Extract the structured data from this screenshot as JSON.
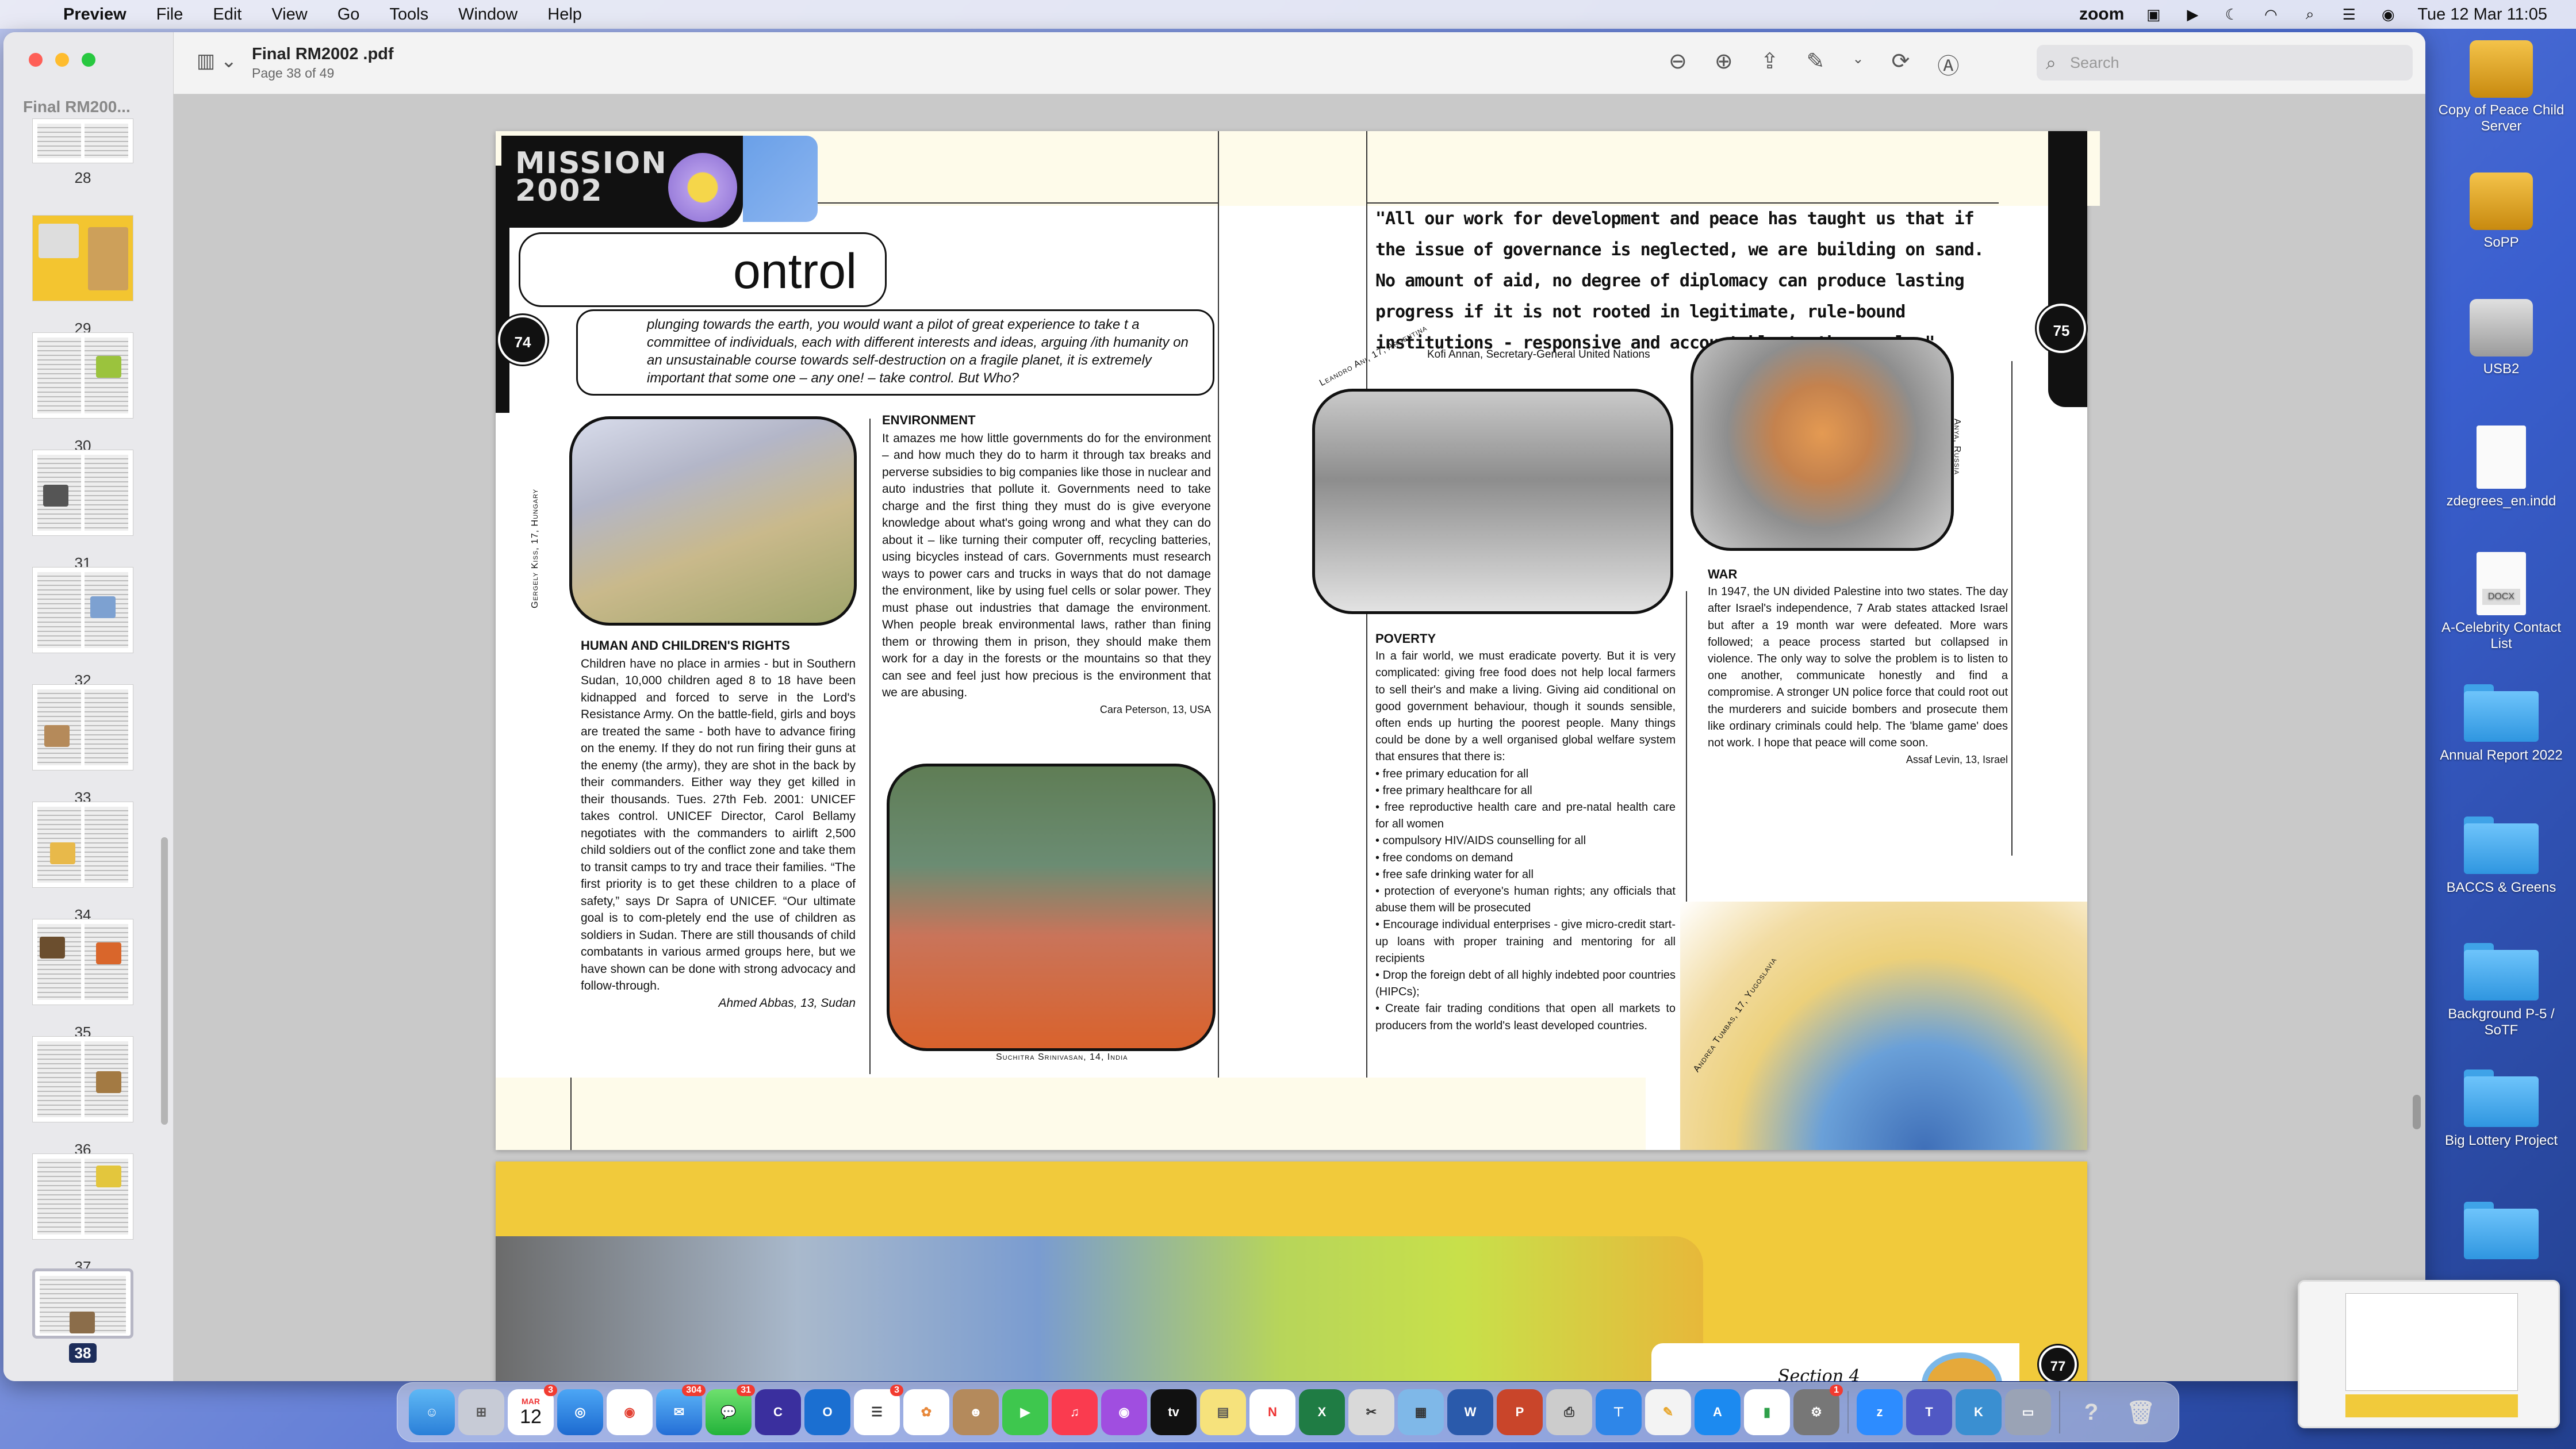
{
  "menubar": {
    "app": "Preview",
    "items": [
      "File",
      "Edit",
      "View",
      "Go",
      "Tools",
      "Window",
      "Help"
    ],
    "zoom": "zoom",
    "datetime": "Tue 12 Mar  11:05"
  },
  "window": {
    "doc_title": "Final RM2002 .pdf",
    "page_info": "Page 38 of 49",
    "search_placeholder": "Search",
    "sidebar_title": "Final RM200...",
    "thumbnails": [
      "28",
      "29",
      "30",
      "31",
      "32",
      "33",
      "34",
      "35",
      "36",
      "37",
      "38"
    ],
    "selected_page": "38"
  },
  "page": {
    "title": "ontrol",
    "intro": "plunging towards the earth, you would want a pilot of great experience to take t a committee of individuals, each with different interests and ideas, arguing /ith humanity on an unsustainable course towards self-destruction on a fragile planet, it is extremely important that some one – any one! – take control. But Who?",
    "page_num_left": "74",
    "page_num_right": "75",
    "page_num_next": "77",
    "human_rights": {
      "heading": "HUMAN AND CHILDREN'S RIGHTS",
      "body": "Children have no place in armies - but in Southern Sudan, 10,000 children aged 8 to 18 have been kidnapped and forced to serve in the Lord's Resistance Army. On the battle-field, girls and boys are treated the same - both have to advance firing on the enemy. If they do not run firing their guns at the enemy (the army), they are shot in the back by their commanders. Either way they get killed in their thousands. Tues. 27th Feb. 2001: UNICEF takes control. UNICEF Director, Carol Bellamy negotiates with the commanders to airlift 2,500 child soldiers out of the conflict zone and take them to transit camps to try and trace their families. “The first priority is to get these children to a place of   safety,” says Dr Sapra of UNICEF. “Our ultimate goal is to com-pletely end the use of children as soldiers in Sudan. There are still thousands of child combatants in various armed groups here, but we have shown can be done with strong advocacy and follow-through.",
      "byline": "Ahmed Abbas, 13, Sudan"
    },
    "environment": {
      "heading": "ENVIRONMENT",
      "body": "It amazes me how little governments do for the environment – and how much they do to harm it through tax breaks and perverse subsidies to big companies like those in nuclear and auto industries that pollute it. Governments need to take charge and the first thing they must do is give everyone knowledge about  what's going wrong and what they can do about it – like turning their computer off, recycling batteries, using bicycles instead of cars. Governments must research ways to power cars and trucks in ways that do not damage the environment, like by using fuel cells or solar power. They must phase out industries that damage the environment. When people break environmental laws, rather than fining them or throwing them in prison, they should make them work for a day in the forests or the mountains so that they can see and feel just how precious is the environment that we are abusing.",
      "byline": "Cara Peterson, 13, USA"
    },
    "quote": "\"All our work for development and peace has taught us that if the issue of governance is neglected, we are building on sand. No amount of aid, no degree of diplomacy can produce lasting progress if it is not rooted in legitimate, rule-bound institutions - responsive and accountable to the people.\"",
    "quote_by": "Kofi Annan, Secretary-General United Nations",
    "poverty": {
      "heading": "POVERTY",
      "body": "In a fair world, we must eradicate poverty. But  it is very complicated: giving free food does not help local farmers to sell their's and make a living. Giving aid conditional on good government behaviour, though it sounds sensible, often ends up hurting the poorest people. Many things could be done by a well organised global welfare system that ensures that there is:",
      "bullets": [
        "free primary education for all",
        "free primary healthcare for all",
        "free reproductive health care and pre-natal health care for all women",
        "compulsory HIV/AIDS counselling for all",
        "free condoms on demand",
        "free safe drinking water for all",
        "protection of everyone's human rights; any officials that abuse them will be prosecuted",
        "Encourage individual enterprises - give micro-credit start-up loans with proper training and mentoring for all recipients",
        "Drop the foreign debt of all highly indebted poor countries (HIPCs);",
        "Create fair trading conditions that open all markets to producers from the world's least developed countries."
      ]
    },
    "war": {
      "heading": "WAR",
      "body": "In 1947, the UN divided Palestine into two states. The day after Israel's independence, 7 Arab states attacked Israel but after a 19 month war were defeated. More wars followed; a peace process started but collapsed in violence. The only way to solve the problem is to listen to one another, communicate honestly and find a compromise. A stronger UN police force that could root out the murderers and suicide bombers and prosecute them like ordinary criminals could help. The 'blame game' does not work. I hope that peace will come soon.",
      "byline": "Assaf Levin, 13, Israel"
    },
    "art_labels": {
      "hungary": "Gergely Kiss, 17, Hungary",
      "india": "Suchitra Srinivasan, 14, India",
      "argentina": "Leandro Ani, 17, Argentina",
      "russia": "Anya, Russia",
      "yugoslavia": "Andrea Tumbas, 17, Yugoslavia"
    },
    "section": "Section 4"
  },
  "desktop": {
    "items": [
      {
        "label": "Copy of Peace Child Server",
        "kind": "drive-gold"
      },
      {
        "label": "SoPP",
        "kind": "drive-gold"
      },
      {
        "label": "USB2",
        "kind": "drive-grey"
      },
      {
        "label": "zdegrees_en.indd",
        "kind": "file"
      },
      {
        "label": "A-Celebrity Contact List",
        "kind": "docx"
      },
      {
        "label": "Annual Report 2022",
        "kind": "folder"
      },
      {
        "label": "BACCS & Greens",
        "kind": "folder"
      },
      {
        "label": "Background P-5 / SoTF",
        "kind": "folder"
      },
      {
        "label": "Big Lottery Project",
        "kind": "folder"
      },
      {
        "label": "",
        "kind": "folder"
      }
    ],
    "docx_tag": "DOCX"
  },
  "dock": {
    "calendar_month": "MAR",
    "calendar_day": "12",
    "badges": {
      "calendar": "3",
      "mail": "304",
      "messages": "31",
      "reminders": "3",
      "teams": "1"
    }
  }
}
